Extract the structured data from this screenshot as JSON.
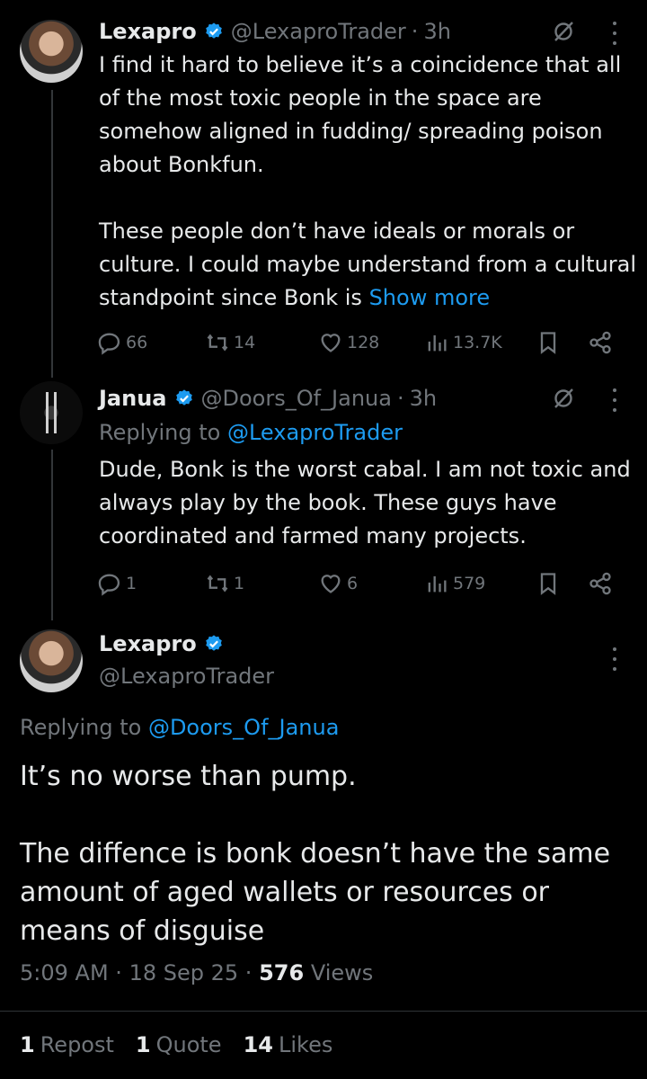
{
  "tweets": [
    {
      "name": "Lexapro",
      "handle": "@LexaproTrader",
      "time": "3h",
      "text": "I find it hard to believe it’s a coincidence that all of the most toxic people in the space are somehow aligned in fudding/ spreading poison about Bonkfun.\n\nThese people don’t have ideals or morals or culture. I could maybe understand from a cultural standpoint since Bonk is ",
      "show_more": "Show more",
      "replies": "66",
      "reposts": "14",
      "likes": "128",
      "views": "13.7K"
    },
    {
      "name": "Janua",
      "handle": "@Doors_Of_Janua",
      "time": "3h",
      "replying_prefix": "Replying to",
      "replying_to": "@LexaproTrader",
      "text": "Dude, Bonk is the worst cabal. I am not toxic and always play by the book. These guys have coordinated and farmed many projects.",
      "replies": "1",
      "reposts": "1",
      "likes": "6",
      "views": "579"
    }
  ],
  "main": {
    "name": "Lexapro",
    "handle": "@LexaproTrader",
    "replying_prefix": "Replying to",
    "replying_to": "@Doors_Of_Janua",
    "text": "It’s no worse than pump.\n\nThe diffence is bonk doesn’t have the same amount of aged wallets or resources or means of disguise",
    "time": "5:09 AM",
    "date": "18 Sep 25",
    "views_count": "576",
    "views_label": "Views",
    "reposts_count": "1",
    "reposts_label": "Repost",
    "quotes_count": "1",
    "quotes_label": "Quote",
    "likes_count": "14",
    "likes_label": "Likes"
  },
  "separator": "·",
  "colors": {
    "background": "#000000",
    "text": "#e7e9ea",
    "muted": "#71767b",
    "link": "#1d9bf0",
    "badge": "#1d9bf0"
  }
}
